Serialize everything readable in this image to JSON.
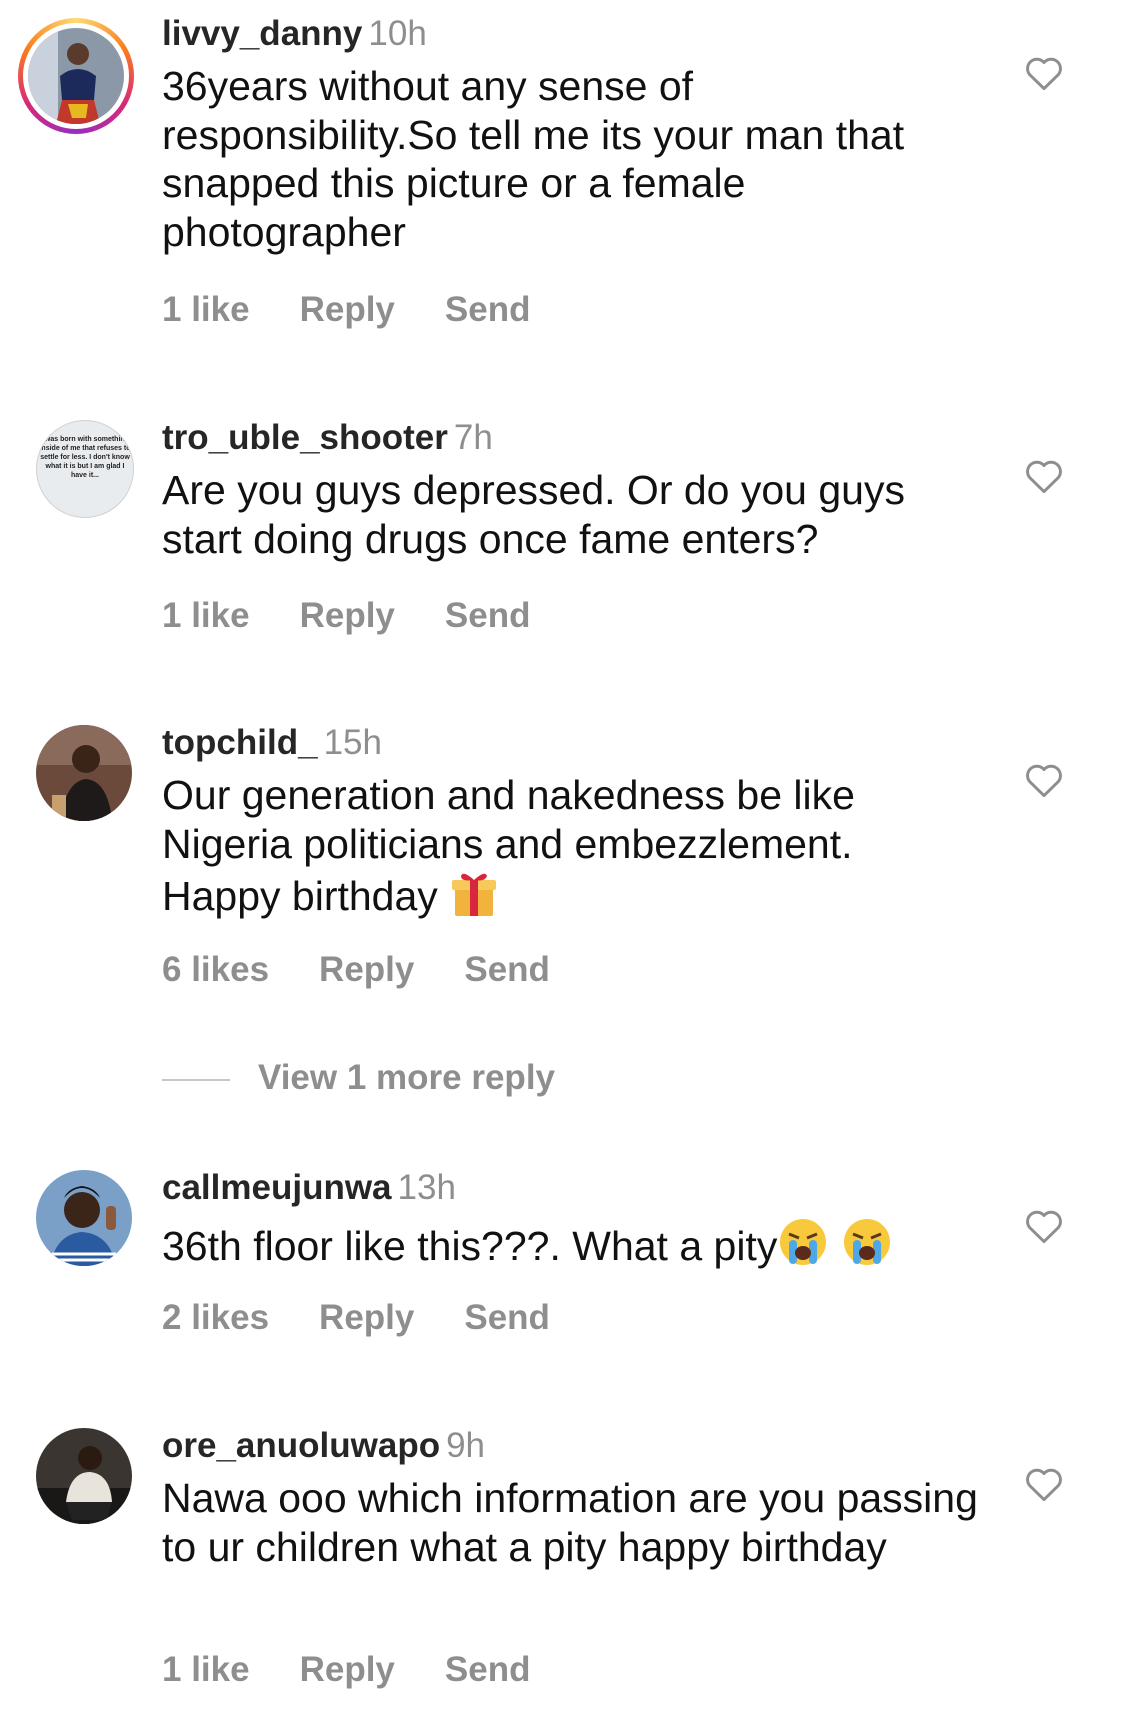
{
  "comments": [
    {
      "username": "livvy_danny",
      "time": "10h",
      "text": "36years without any sense of responsibility.So tell me its your man that snapped this picture or a female photographer",
      "likes": "1 like",
      "reply": "Reply",
      "send": "Send"
    },
    {
      "username": "tro_uble_shooter",
      "time": "7h",
      "text": "Are you guys depressed. Or do you guys start doing drugs once fame enters?",
      "likes": "1 like",
      "reply": "Reply",
      "send": "Send",
      "avatar_text": "I was born with something inside of me that refuses to settle for less. I don't know what it is but I am glad I have it..."
    },
    {
      "username": "topchild_",
      "time": "15h",
      "text": "Our generation and nakedness be like Nigeria politicians and embezzlement. Happy birthday",
      "emoji": "gift-emoji",
      "likes": "6 likes",
      "reply": "Reply",
      "send": "Send",
      "view_more": "View 1 more reply"
    },
    {
      "username": "callmeujunwa",
      "time": "13h",
      "text": "36th floor like this???. What a pity",
      "emoji": "crying-face-emoji",
      "likes": "2 likes",
      "reply": "Reply",
      "send": "Send"
    },
    {
      "username": "ore_anuoluwapo",
      "time": "9h",
      "text": "Nawa ooo which information are you passing to ur children what a pity happy birthday",
      "likes": "1 like",
      "reply": "Reply",
      "send": "Send"
    }
  ],
  "colors": {
    "text": "#111111",
    "muted": "#8e8e8e",
    "username": "#262626"
  },
  "icons": {
    "like": "heart-outline-icon"
  }
}
